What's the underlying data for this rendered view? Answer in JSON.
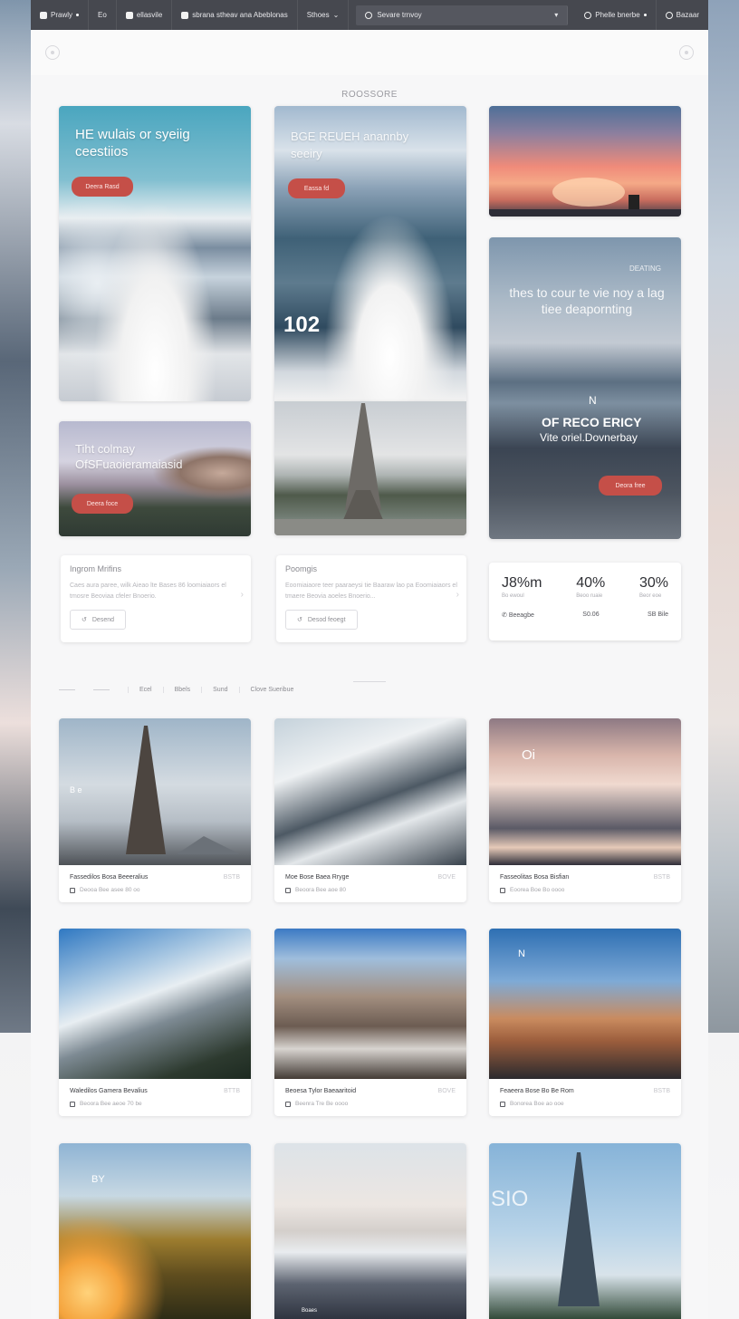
{
  "topbar": {
    "brand": "Prawly",
    "item2": "Eo",
    "item3": "ellasvile",
    "item4": "sbrana stheav ana Abeblonas",
    "item5": "Sthoes",
    "search_placeholder": "Sevare trnvoy",
    "user_name": "Phelle bnerbe",
    "user_extra": "Bazaar"
  },
  "section_title": "ROOSSORE",
  "heroes": {
    "hero1_text": "HE wulais or syeiig ceestiios",
    "hero1_button": "Deera Rasd",
    "hero2_text": "BGE REUEH anannby seeiry",
    "hero2_button": "Eassa fd",
    "hero2_number": "102",
    "small_hero_text": "Tiht colmay OfSFuaoieramaiasid",
    "small_hero_button": "Deera foce",
    "hero3_label": "DEATING",
    "hero3_text": "thes to cour te vie noy a lag tiee deapornting",
    "hero3_n": "N",
    "hero3_title": "OF RECO ERICY",
    "hero3_sub": "Vite oriel.Dovnerbay",
    "hero3_button": "Deora free"
  },
  "info_cards": [
    {
      "title": "Ingrom Mrifins",
      "body": "Caes aura paree, wilk Aieao lte Bases 86 loomiaiaors el tmosre Beoviaa cfeler Bnoerio.",
      "button": "Desend"
    },
    {
      "title": "Poomgis",
      "body": "Eoomiaiaore teer paaraeysi tie Baaraw lao pa Eoomiaiaors el tmaere Beovia aoeles Bnoerio...",
      "button": "Desod feoegt"
    }
  ],
  "stats": {
    "v1": "J8%m",
    "l1": "Bo ewoul",
    "v2": "40%",
    "l2": "Beoo ruaie",
    "v3": "30%",
    "l3": "Beor eoe",
    "f1": "Beeagbe",
    "f2": "S0.06",
    "f3": "SB Bile"
  },
  "tabs": [
    "Ecel",
    "Bbels",
    "Sund",
    "Clove Sueribue"
  ],
  "grid": [
    {
      "title": "Fassedilos Bosa Beeeralius",
      "tag": "BSTB",
      "sub": "Deooa Bee  asee 80 oo",
      "overlay": "B e"
    },
    {
      "title": "Moe Bose Baea Rryge",
      "tag": "BOVE",
      "sub": "Beoora Bee  aoe 80",
      "overlay": ""
    },
    {
      "title": "Fasseolitas Bosa Bisfian",
      "tag": "BSTB",
      "sub": "Eoorea Boe  Bo oooo",
      "overlay": "Oi"
    },
    {
      "title": "Waledilos Gamera Bevalius",
      "tag": "BTTB",
      "sub": "Beoora  Bee aeoe 70 be",
      "overlay": ""
    },
    {
      "title": "Beoesa Tylor Baeaaritoid",
      "tag": "BOVE",
      "sub": "Beenra Tre  Be oooo",
      "overlay": ""
    },
    {
      "title": "Feaeera Bose Bo Be Rom",
      "tag": "BSTB",
      "sub": "Bonorea Boe  ao ooe",
      "overlay": "N"
    },
    {
      "title": "",
      "tag": "",
      "sub": "",
      "overlay": "BY"
    },
    {
      "title": "",
      "tag": "",
      "sub": "Boaes",
      "overlay": ""
    },
    {
      "title": "",
      "tag": "",
      "sub": "",
      "overlay": "SIO"
    }
  ]
}
